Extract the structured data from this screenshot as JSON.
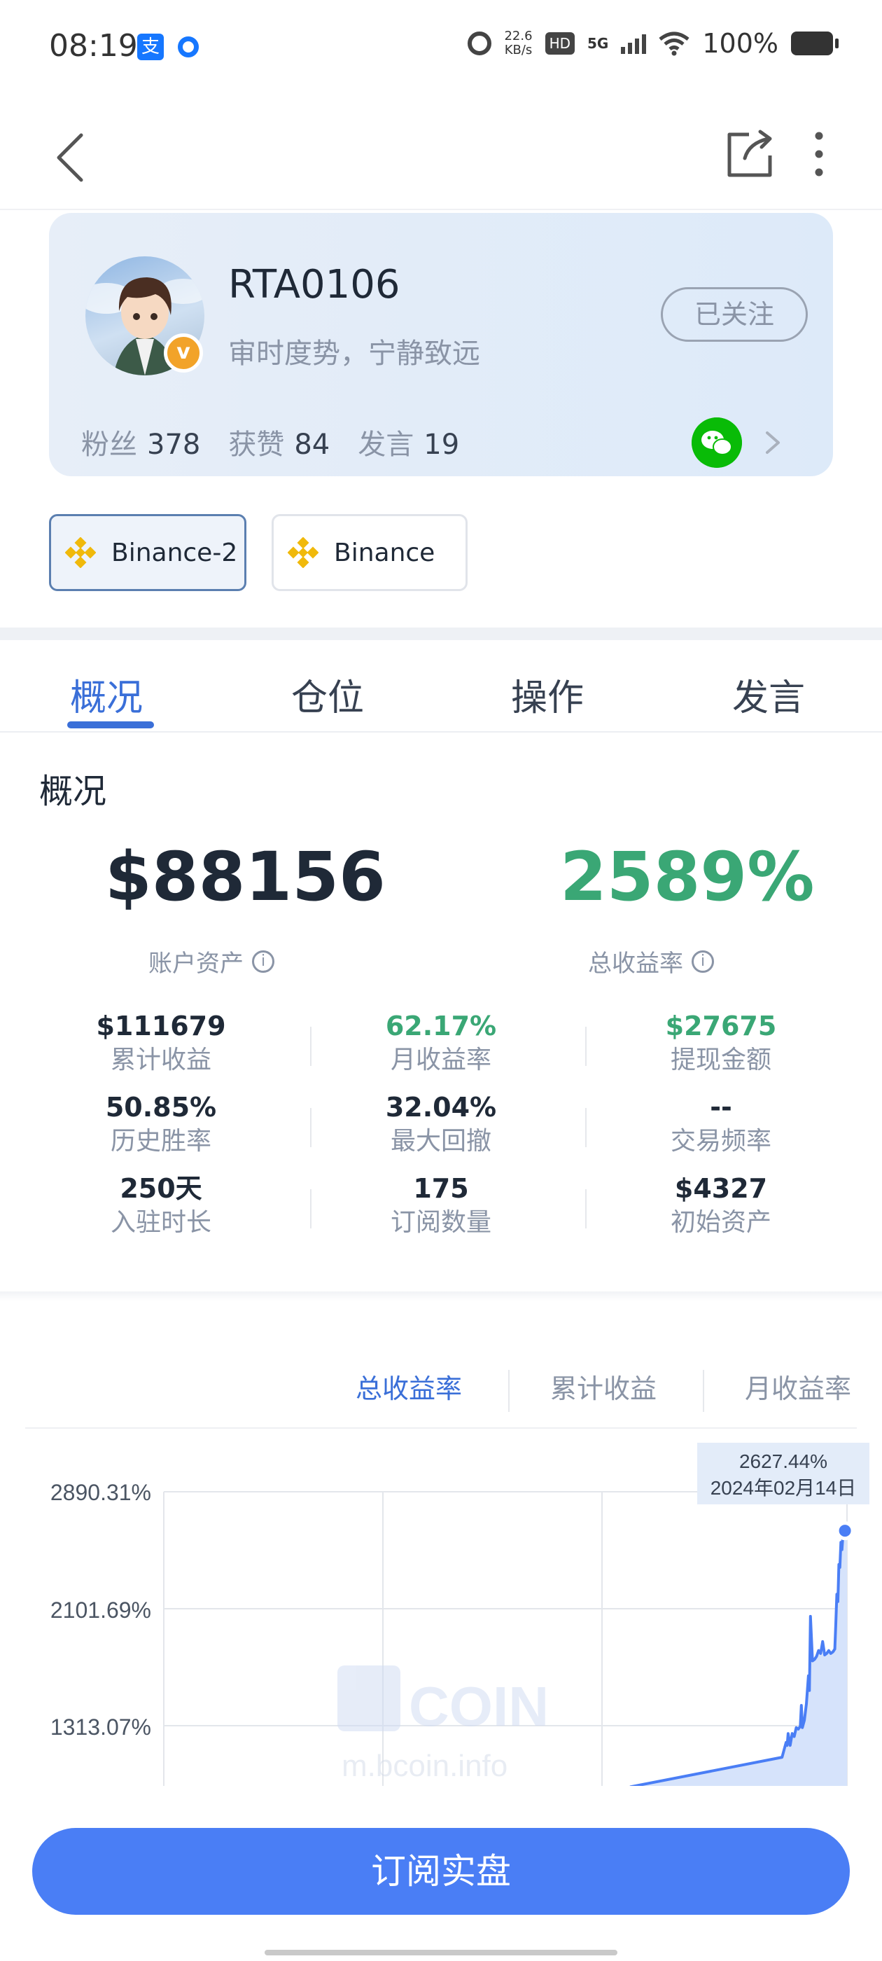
{
  "status_bar": {
    "time": "08:19",
    "net_speed_value": "22.6",
    "net_speed_unit": "KB/s",
    "hd": "HD",
    "network": "5G",
    "battery": "100%"
  },
  "profile": {
    "name": "RTA0106",
    "bio": "审时度势，宁静致远",
    "follow_label": "已关注",
    "badge": "v",
    "stats": [
      {
        "label": "粉丝",
        "value": "378"
      },
      {
        "label": "获赞",
        "value": "84"
      },
      {
        "label": "发言",
        "value": "19"
      }
    ]
  },
  "exchanges": [
    {
      "label": "Binance-2",
      "active": true
    },
    {
      "label": "Binance",
      "active": false
    }
  ],
  "main_tabs": [
    "概况",
    "仓位",
    "操作",
    "发言"
  ],
  "overview": {
    "title": "概况",
    "account_asset": "$88156",
    "account_asset_label": "账户资产",
    "total_yield": "2589%",
    "total_yield_label": "总收益率",
    "info_glyph": "i",
    "metrics": [
      [
        {
          "value": "$111679",
          "label": "累计收益"
        },
        {
          "value": "62.17%",
          "label": "月收益率"
        },
        {
          "value": "$27675",
          "label": "提现金额"
        }
      ],
      [
        {
          "value": "50.85%",
          "label": "历史胜率"
        },
        {
          "value": "32.04%",
          "label": "最大回撤"
        },
        {
          "value": "--",
          "label": "交易频率"
        }
      ],
      [
        {
          "value": "250天",
          "label": "入驻时长"
        },
        {
          "value": "175",
          "label": "订阅数量"
        },
        {
          "value": "$4327",
          "label": "初始资产"
        }
      ]
    ]
  },
  "chart_tabs": [
    "总收益率",
    "累计收益",
    "月收益率"
  ],
  "chart_data": {
    "type": "area",
    "title": "",
    "xlabel": "",
    "ylabel": "",
    "yticks": [
      "2890.31%",
      "2101.69%",
      "1313.07%"
    ],
    "ytick_values": [
      2890.31,
      2101.69,
      1313.07
    ],
    "tooltip": {
      "value": "2627.44%",
      "date": "2024年02月14日"
    },
    "watermark_brand": "COIN",
    "watermark_site": "m.bcoin.info",
    "grid": true,
    "color": "#4a7ef5",
    "series": [
      {
        "x_fraction": [
          0.0,
          0.68,
          0.7,
          0.705,
          0.71,
          0.715,
          0.72,
          0.73,
          0.74,
          0.75,
          0.76,
          0.77,
          0.775,
          0.78,
          0.79,
          0.8,
          0.81,
          0.815,
          0.82,
          0.83,
          0.84,
          0.85,
          0.86,
          0.87,
          0.88,
          0.89,
          0.9,
          0.91,
          0.92,
          0.93,
          0.935,
          0.94,
          0.945,
          0.95,
          0.955,
          0.96,
          0.965,
          0.97,
          0.975,
          0.98,
          0.985,
          0.99,
          0.995,
          1.0
        ],
        "values": [
          900,
          1100,
          1200,
          1180,
          1260,
          1220,
          1180,
          1260,
          1240,
          1300,
          1290,
          1310,
          1450,
          1300,
          1350,
          1460,
          1650,
          1550,
          2050,
          1750,
          1760,
          1780,
          1820,
          1800,
          1880,
          1790,
          1800,
          1820,
          1800,
          1810,
          1820,
          1830,
          2000,
          2200,
          2150,
          2400,
          2380,
          2550,
          2500,
          2600,
          2580,
          2627.44,
          2600,
          2630
        ]
      }
    ]
  }
}
